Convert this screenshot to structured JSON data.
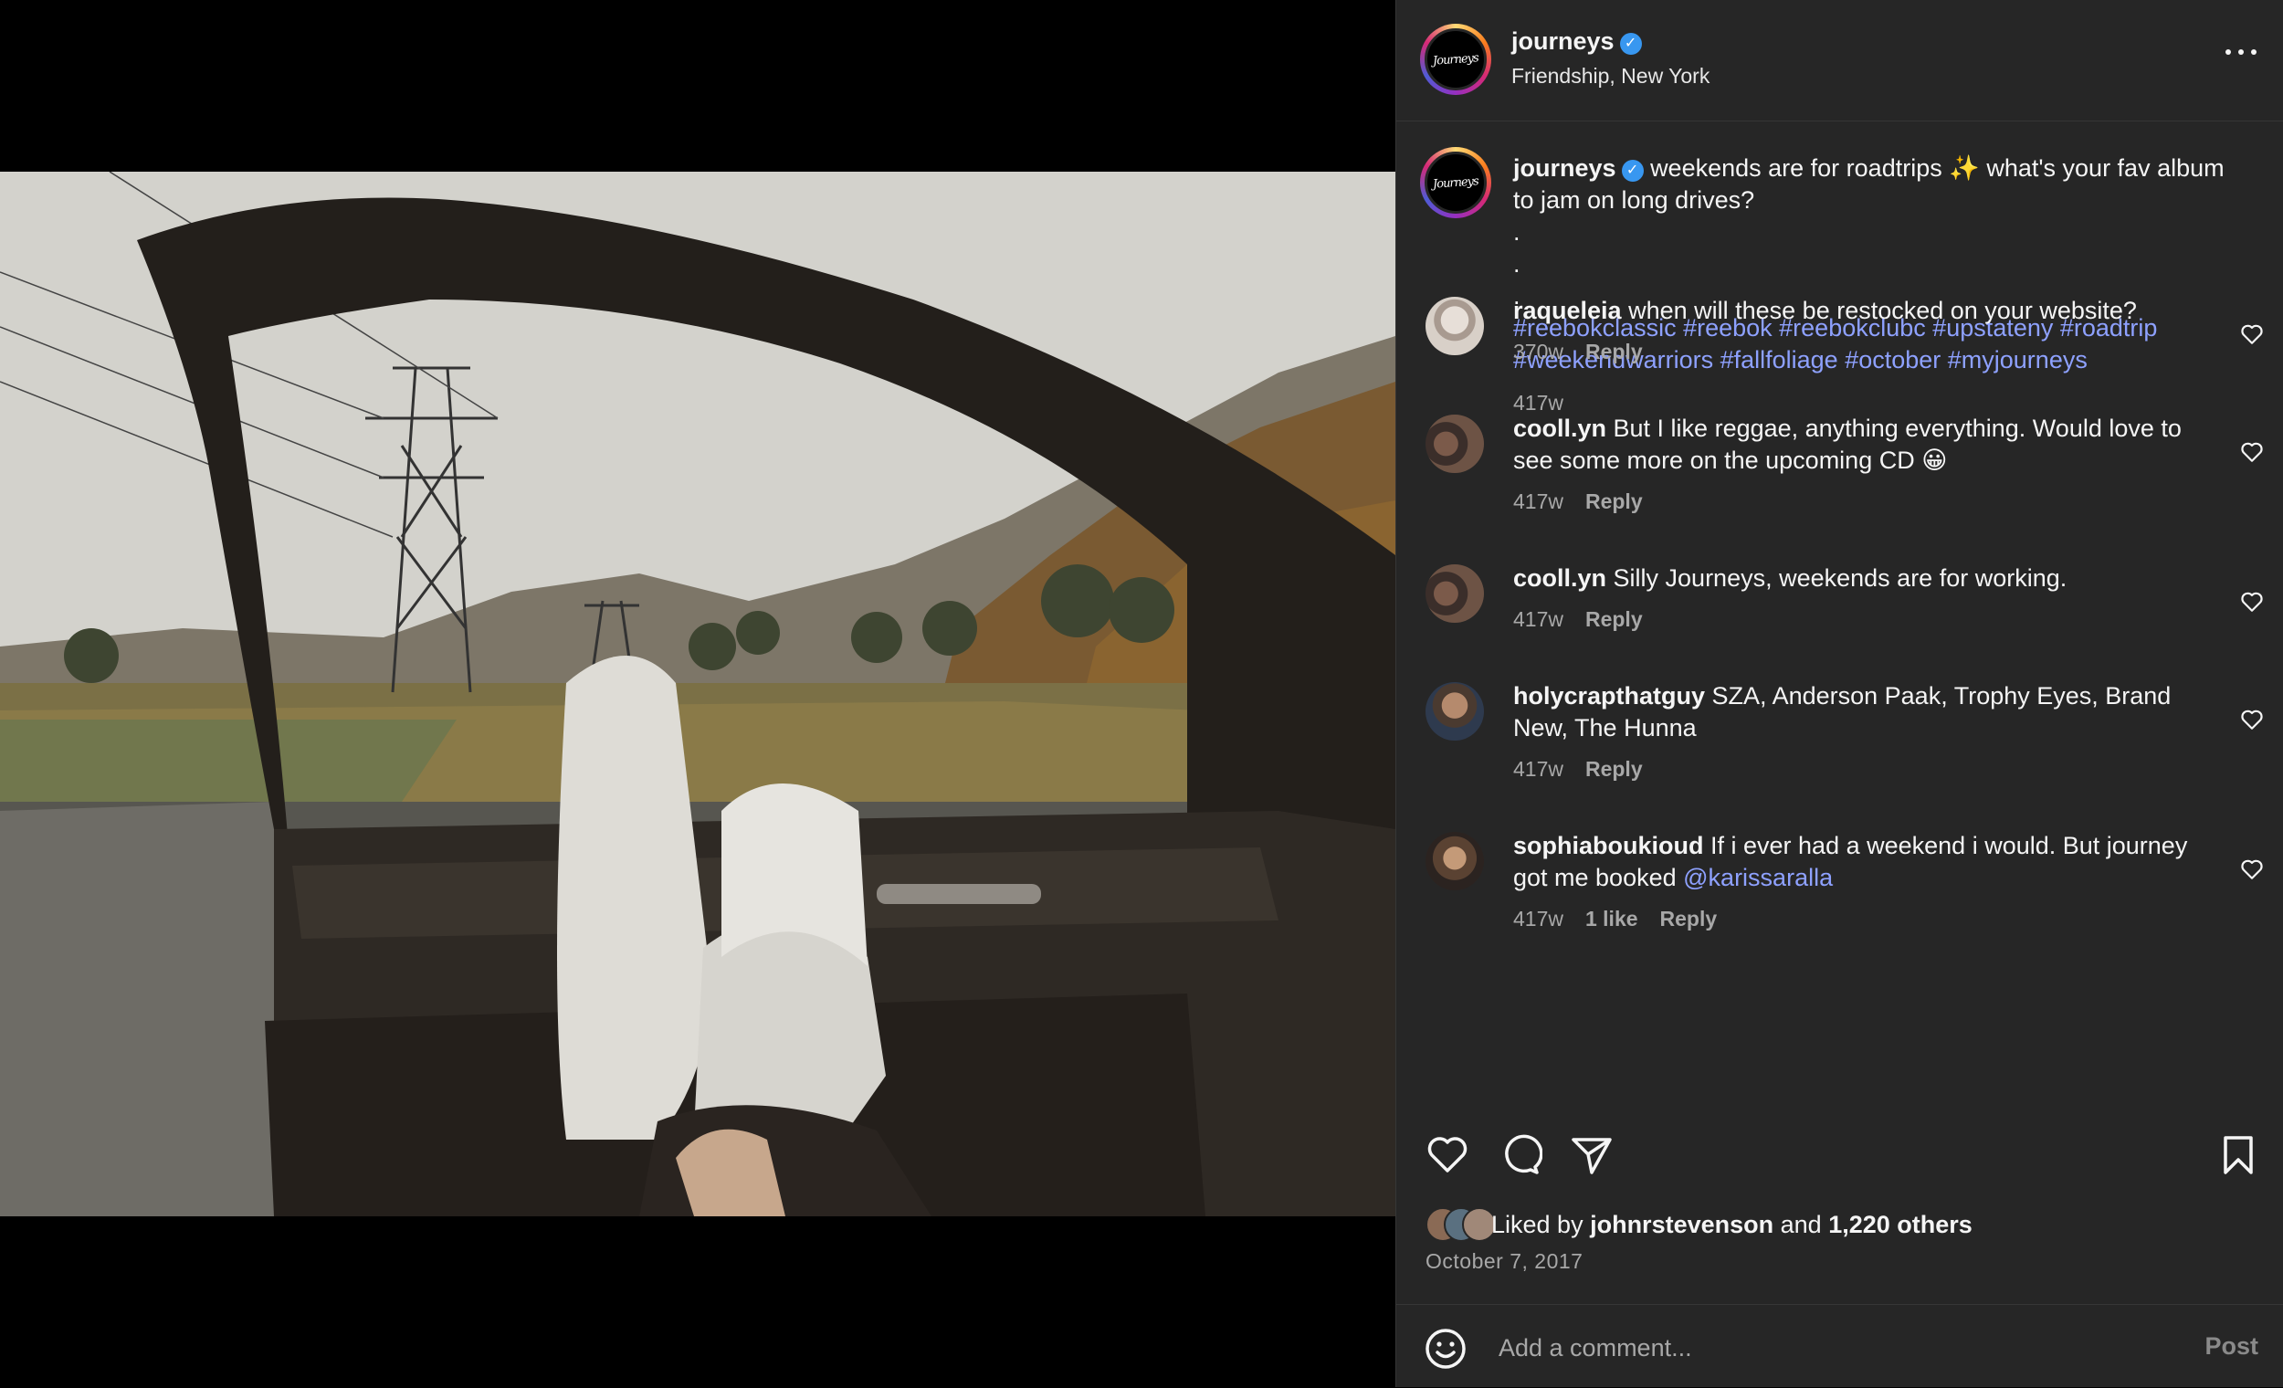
{
  "post": {
    "username": "journeys",
    "verified_icon": "verified-badge-icon",
    "location": "Friendship, New York",
    "avatar_logo_text": "Journeys",
    "caption_text": "weekends are for roadtrips ✨ what's your fav album to jam on long drives?",
    "caption_dots": [
      ".",
      ".",
      "."
    ],
    "hashtags_line1": "#reebokclassic #reebok #reebokclubc #upstateny #roadtrip",
    "hashtags_line2": "#weekendwarriors #fallfoliage #october #myjourneys",
    "caption_time": "417w"
  },
  "comments": [
    {
      "user": "raqueleia",
      "text": "when will these be restocked on your website?",
      "time": "370w",
      "likes": "",
      "reply": "Reply"
    },
    {
      "user": "cooll.yn",
      "text": "But I like reggae, anything everything. Would love to see some more on the upcoming CD 😀",
      "time": "417w",
      "likes": "",
      "reply": "Reply"
    },
    {
      "user": "cooll.yn",
      "text": "Silly Journeys, weekends are for working.",
      "time": "417w",
      "likes": "",
      "reply": "Reply"
    },
    {
      "user": "holycrapthatguy",
      "text": "SZA, Anderson Paak, Trophy Eyes, Brand New, The Hunna",
      "time": "417w",
      "likes": "",
      "reply": "Reply"
    },
    {
      "user": "sophiaboukioud",
      "text": "If i ever had a weekend i would. But journey got me booked",
      "mention": "@karissaralla",
      "time": "417w",
      "likes": "1 like",
      "reply": "Reply"
    }
  ],
  "actions": {
    "like_icon": "heart-icon",
    "comment_icon": "comment-bubble-icon",
    "share_icon": "paper-plane-icon",
    "save_icon": "bookmark-icon"
  },
  "likes": {
    "prefix": "Liked by ",
    "user": "johnrstevenson",
    "middle": " and ",
    "others": "1,220 others"
  },
  "date": "October 7, 2017",
  "add_comment": {
    "placeholder": "Add a comment...",
    "post_label": "Post",
    "emoji_icon": "smiley-icon"
  },
  "colors": {
    "panel_bg": "#262626",
    "link": "#8ea1ff",
    "verified": "#3897f0",
    "muted": "#a8a8a8"
  }
}
